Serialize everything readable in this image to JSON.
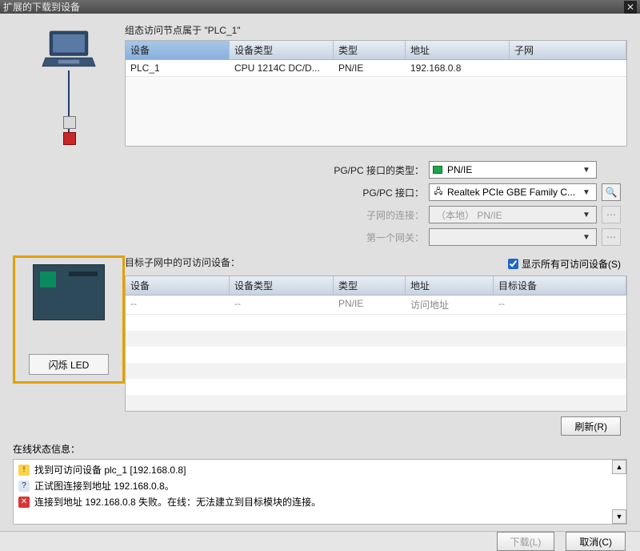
{
  "title": "扩展的下载到设备",
  "sectionLabels": {
    "configNodes": "组态访问节点属于 \"PLC_1\"",
    "targetSubnet": "目标子网中的可访问设备：",
    "onlineStatus": "在线状态信息："
  },
  "columns": {
    "device": "设备",
    "deviceType": "设备类型",
    "type": "类型",
    "address": "地址",
    "subnet": "子网",
    "target": "目标设备"
  },
  "configRow": {
    "device": "PLC_1",
    "deviceType": "CPU 1214C DC/D...",
    "type": "PN/IE",
    "address": "192.168.0.8",
    "subnet": ""
  },
  "settings": {
    "pgpcTypeLabel": "PG/PC 接口的类型：",
    "pgpcType": "PN/IE",
    "pgpcIfaceLabel": "PG/PC 接口：",
    "pgpcIface": "Realtek PCIe GBE Family C...",
    "subnetConnLabel": "子网的连接：",
    "subnetConn": "（本地） PN/IE",
    "firstGwLabel": "第一个网关："
  },
  "showAll": "显示所有可访问设备(S)",
  "targetRow": {
    "device": "--",
    "deviceType": "--",
    "type": "PN/IE",
    "address": "访问地址",
    "target": "--"
  },
  "ledBtn": "闪烁 LED",
  "refreshBtn": "刷新(R)",
  "status": {
    "l1": "找到可访问设备 plc_1 [192.168.0.8]",
    "l2": "正试图连接到地址 192.168.0.8。",
    "l3": "连接到地址 192.168.0.8 失败。在线：无法建立到目标模块的连接。"
  },
  "footer": {
    "download": "下载(L)",
    "cancel": "取消(C)"
  }
}
